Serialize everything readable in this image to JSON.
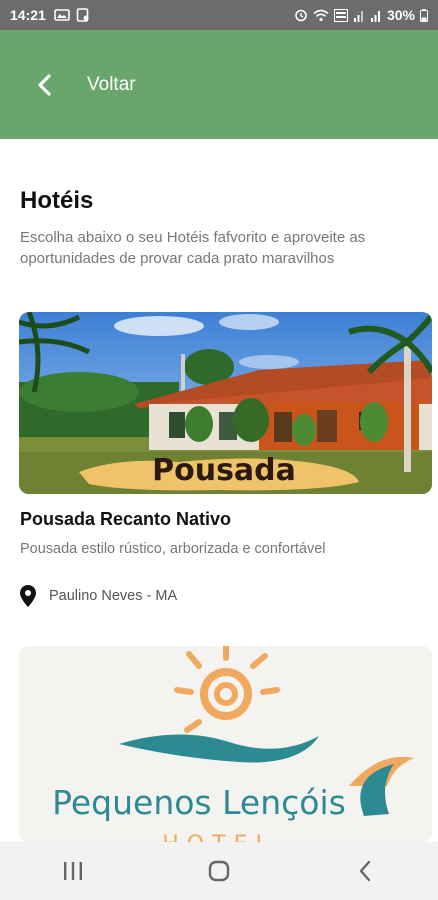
{
  "status_bar": {
    "time": "14:21",
    "battery": "30%"
  },
  "header": {
    "back_label": "Voltar",
    "color": "#6aa56c"
  },
  "page": {
    "title": "Hotéis",
    "description": "Escolha abaixo o seu Hotéis fafvorito e aproveite as oportunidades de provar cada prato maravilhos"
  },
  "hotels": [
    {
      "image_caption": "Pousada",
      "name": "Pousada Recanto Nativo",
      "description": "Pousada estilo rústico, arborizada e confortável",
      "location": "Paulino Neves - MA"
    },
    {
      "image_caption": "Pequenos Lençóis",
      "image_caption_partial": "HOTEL"
    }
  ],
  "icons": {
    "back": "chevron-left-icon",
    "location": "map-pin-icon",
    "nav_recents": "recents-icon",
    "nav_home": "home-icon",
    "nav_back": "back-icon"
  }
}
